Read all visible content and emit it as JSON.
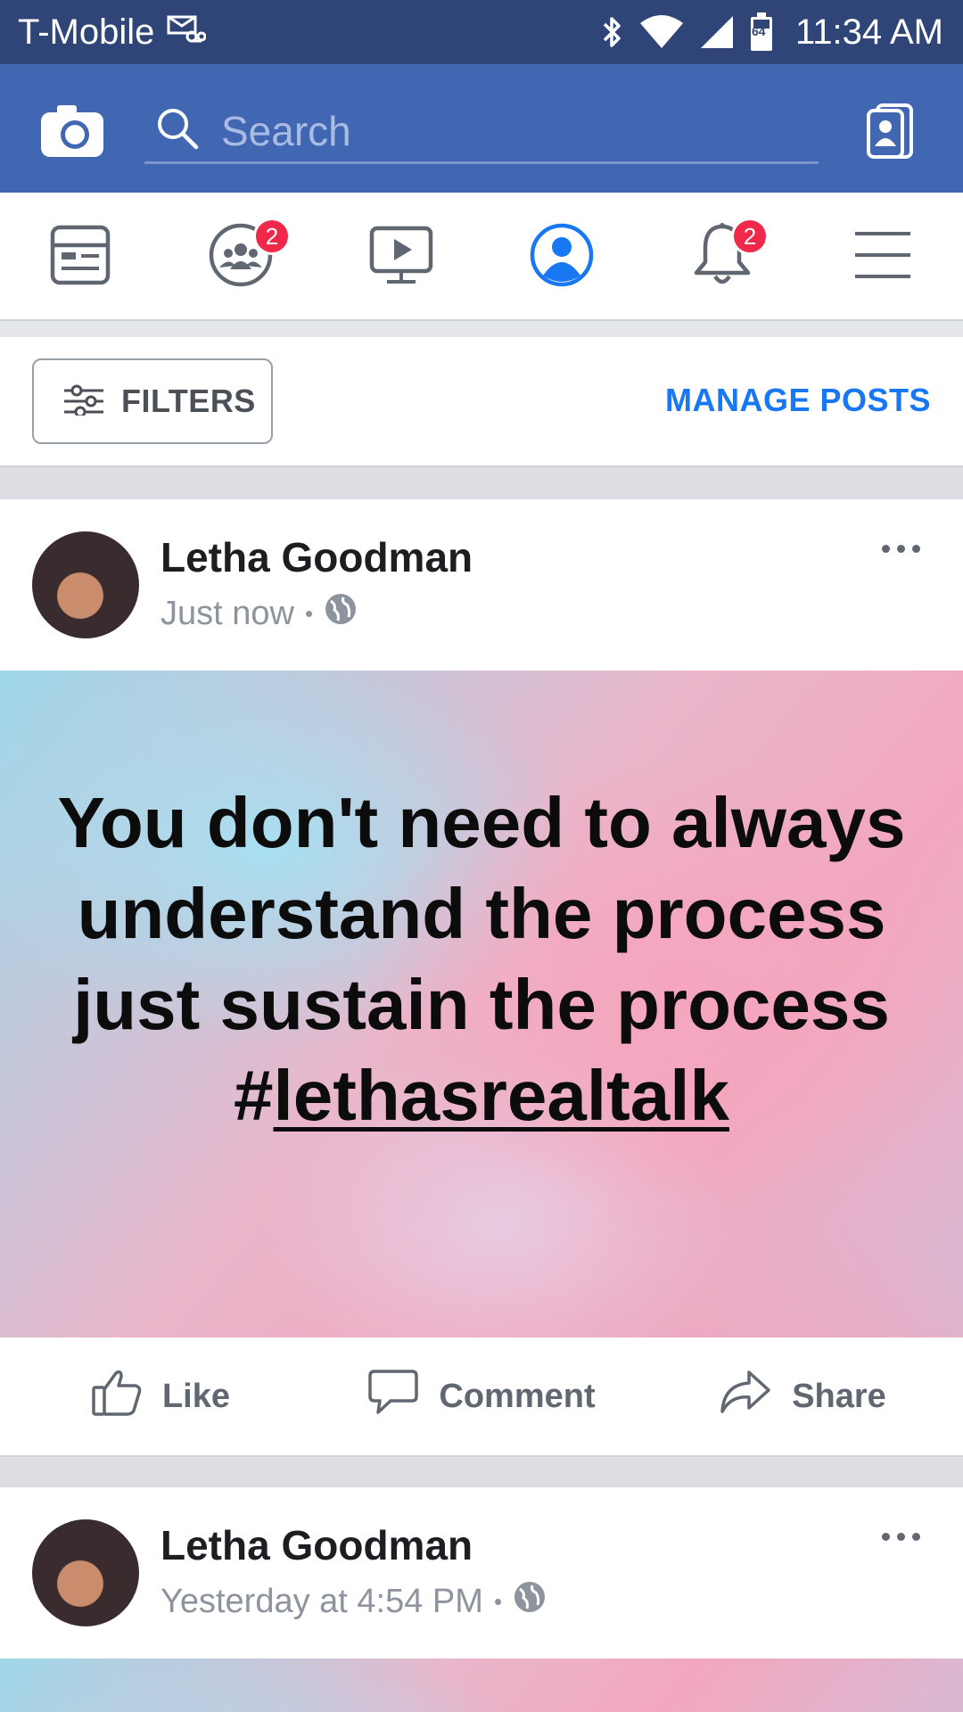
{
  "status_bar": {
    "carrier": "T-Mobile",
    "battery_level": "64",
    "time": "11:34 AM",
    "icons": [
      "voicemail-icon",
      "bluetooth-icon",
      "wifi-icon",
      "signal-icon",
      "battery-icon"
    ]
  },
  "app_bar": {
    "search_placeholder": "Search",
    "icons": [
      "camera-icon",
      "search-icon",
      "messenger-contacts-icon"
    ],
    "bg_color": "#4267b2"
  },
  "nav_tabs": [
    {
      "name": "news-feed",
      "icon": "news-feed-icon",
      "badge": ""
    },
    {
      "name": "groups",
      "icon": "groups-icon",
      "badge": "2"
    },
    {
      "name": "watch",
      "icon": "watch-icon",
      "badge": ""
    },
    {
      "name": "profile",
      "icon": "profile-icon",
      "badge": "",
      "active": true
    },
    {
      "name": "notifications",
      "icon": "bell-icon",
      "badge": "2"
    },
    {
      "name": "menu",
      "icon": "hamburger-menu-icon",
      "badge": ""
    }
  ],
  "filters_bar": {
    "filters_label": "FILTERS",
    "manage_posts_label": "MANAGE POSTS",
    "accent_color": "#1877f2"
  },
  "posts": [
    {
      "author": "Letha Goodman",
      "timestamp": "Just now",
      "separator": "•",
      "privacy_icon": "globe-icon",
      "text_main": "You don't need to always understand the process just sustain the process ",
      "hashtag_prefix": "#",
      "hashtag": "lethasrealtalk"
    },
    {
      "author": "Letha Goodman",
      "timestamp": "Yesterday at 4:54 PM",
      "separator": "•",
      "privacy_icon": "globe-icon"
    }
  ],
  "actions": {
    "like": "Like",
    "comment": "Comment",
    "share": "Share"
  }
}
